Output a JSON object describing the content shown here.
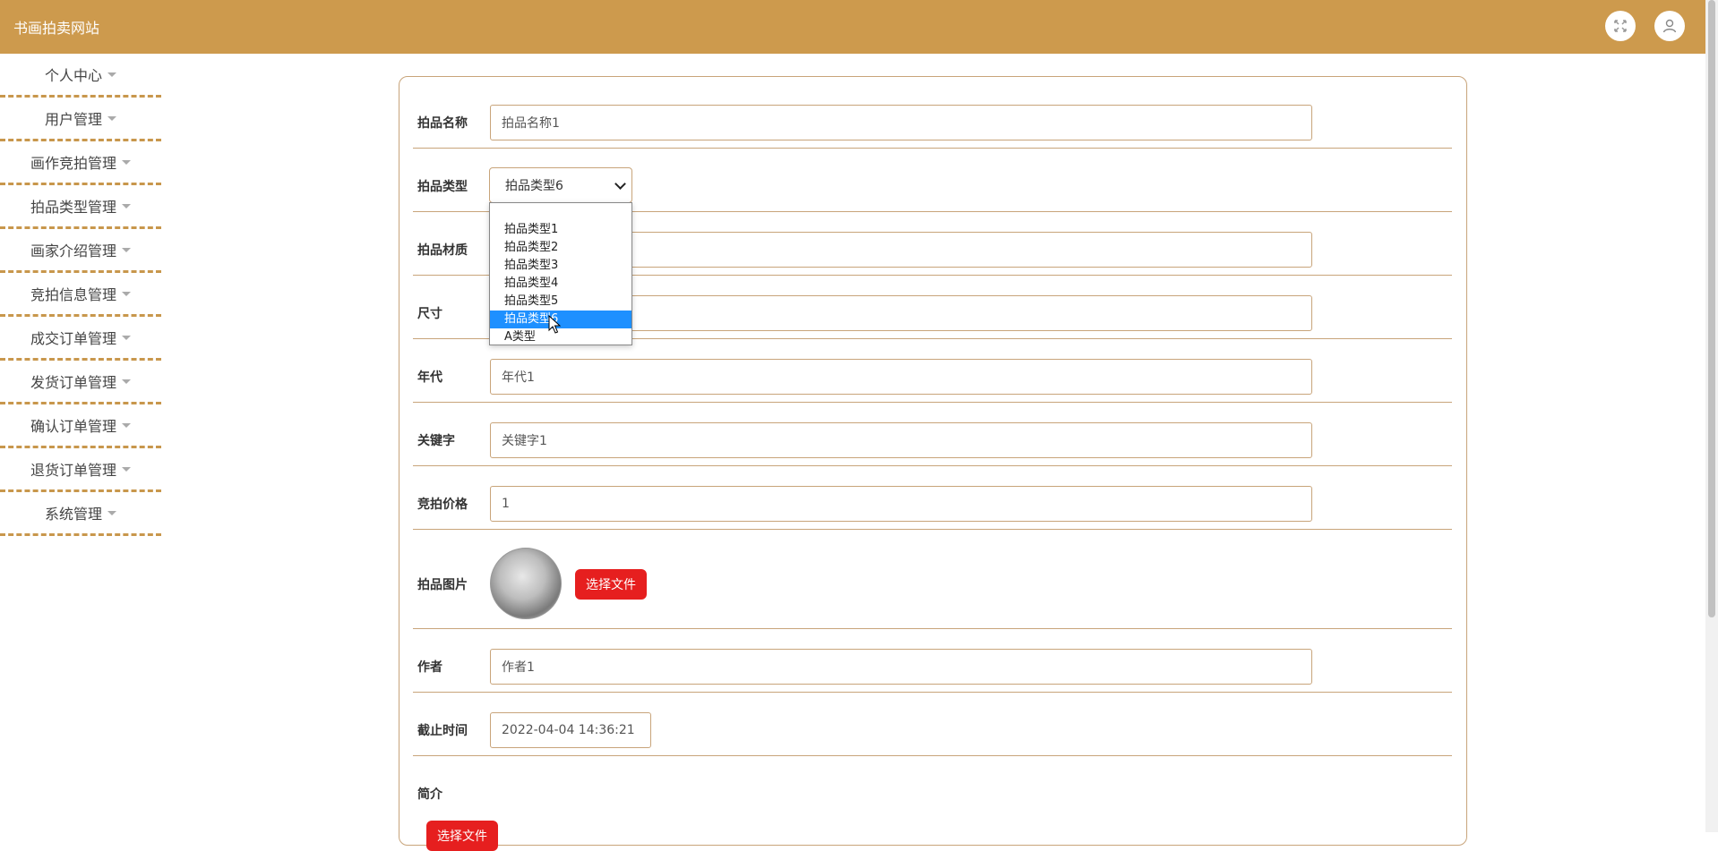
{
  "header": {
    "site_title": "书画拍卖网站"
  },
  "sidebar": {
    "items": [
      {
        "label": "个人中心"
      },
      {
        "label": "用户管理"
      },
      {
        "label": "画作竞拍管理"
      },
      {
        "label": "拍品类型管理"
      },
      {
        "label": "画家介绍管理"
      },
      {
        "label": "竞拍信息管理"
      },
      {
        "label": "成交订单管理"
      },
      {
        "label": "发货订单管理"
      },
      {
        "label": "确认订单管理"
      },
      {
        "label": "退货订单管理"
      },
      {
        "label": "系统管理"
      }
    ]
  },
  "form": {
    "name": {
      "label": "拍品名称",
      "value": "拍品名称1"
    },
    "type": {
      "label": "拍品类型",
      "value": "拍品类型6",
      "options": [
        "拍品类型1",
        "拍品类型2",
        "拍品类型3",
        "拍品类型4",
        "拍品类型5",
        "拍品类型6",
        "A类型"
      ]
    },
    "material": {
      "label": "拍品材质"
    },
    "size": {
      "label": "尺寸"
    },
    "era": {
      "label": "年代",
      "value": "年代1"
    },
    "keyword": {
      "label": "关键字",
      "value": "关键字1"
    },
    "price": {
      "label": "竞拍价格",
      "value": "1"
    },
    "image": {
      "label": "拍品图片",
      "button": "选择文件"
    },
    "author": {
      "label": "作者",
      "value": "作者1"
    },
    "deadline": {
      "label": "截止时间",
      "value": "2022-04-04 14:36:21"
    },
    "intro": {
      "label": "简介",
      "button": "选择文件"
    }
  },
  "colors": {
    "header_bg": "#cd9a4d",
    "accent_red": "#e61f1f",
    "selected_option": "#1e90ff"
  }
}
